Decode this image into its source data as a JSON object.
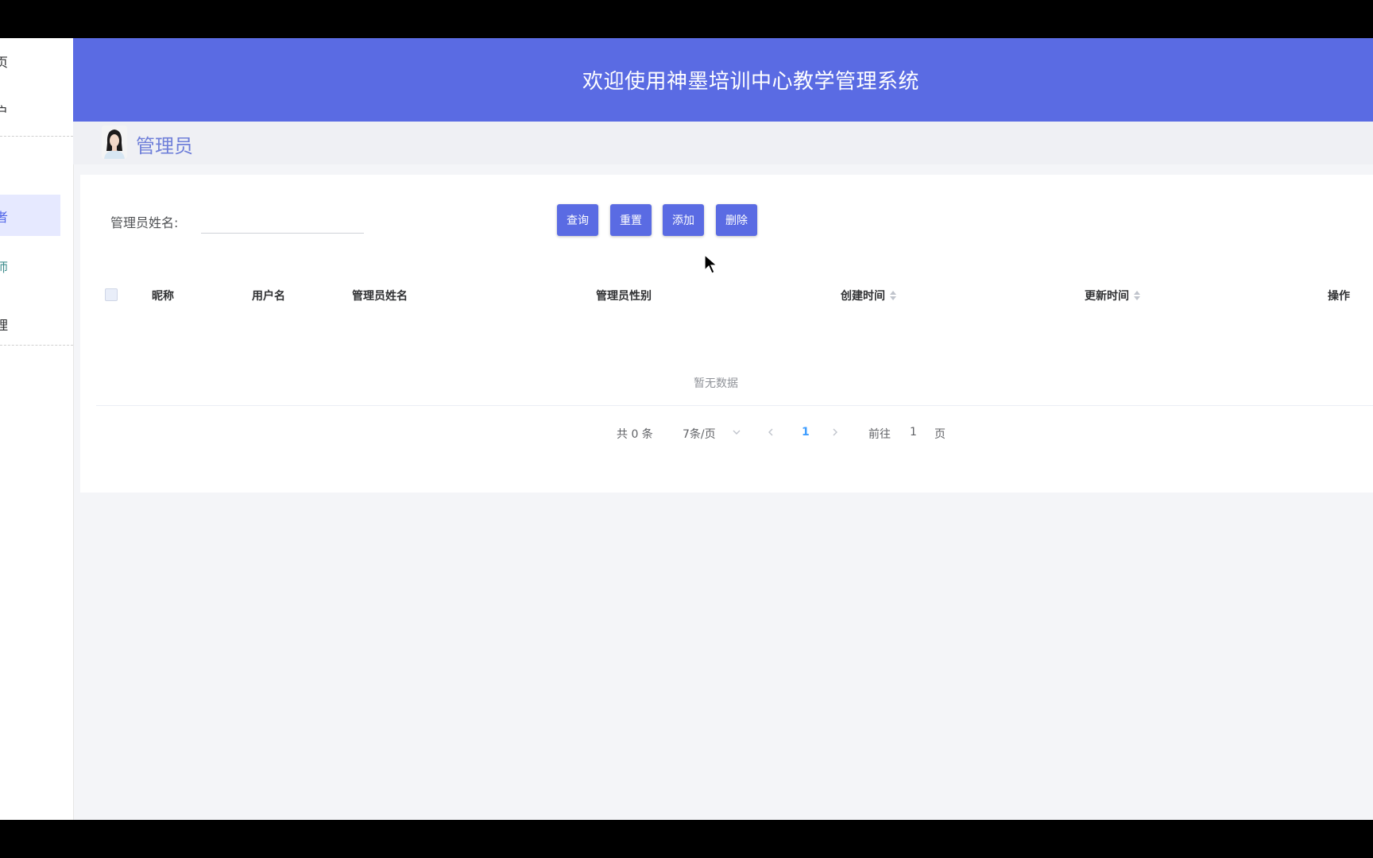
{
  "header": {
    "title": "欢迎使用神墨培训中心教学管理系统"
  },
  "sidebar": {
    "items": [
      {
        "label": "页"
      },
      {
        "label": "户"
      },
      {
        "label": "者"
      },
      {
        "label": "师"
      },
      {
        "label": "理"
      }
    ]
  },
  "page": {
    "title": "管理员"
  },
  "search": {
    "label": "管理员姓名:",
    "value": ""
  },
  "buttons": {
    "query": "查询",
    "reset": "重置",
    "add": "添加",
    "delete": "删除"
  },
  "table": {
    "columns": [
      "昵称",
      "用户名",
      "管理员姓名",
      "管理员性别",
      "创建时间",
      "更新时间",
      "操作"
    ],
    "empty_text": "暂无数据"
  },
  "pagination": {
    "total": "共 0 条",
    "page_size": "7条/页",
    "current_page": "1",
    "goto_label": "前往",
    "goto_value": "1",
    "page_suffix": "页"
  },
  "colors": {
    "primary": "#5a6be3",
    "header_bg": "#5a6be3",
    "title_color": "#6f7fd9"
  }
}
